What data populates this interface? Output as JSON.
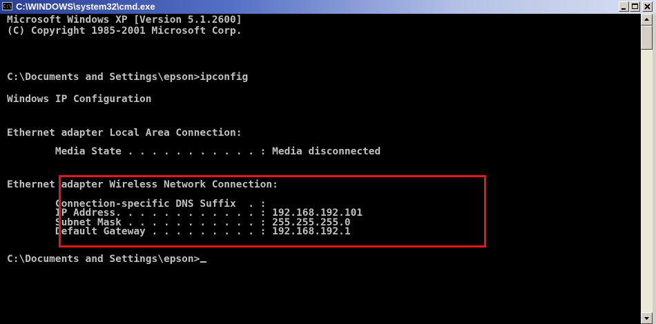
{
  "window": {
    "title": "C:\\WINDOWS\\system32\\cmd.exe",
    "icon": "cmd-icon",
    "icon_text": "C:\\",
    "controls": [
      "minimize",
      "maximize",
      "close"
    ]
  },
  "console": {
    "lines": [
      "Microsoft Windows XP [Version 5.1.2600]",
      "(C) Copyright 1985-2001 Microsoft Corp.",
      "",
      "C:\\Documents and Settings\\epson>ipconfig",
      "",
      "Windows IP Configuration",
      "",
      "",
      "Ethernet adapter Local Area Connection:",
      "",
      "        Media State . . . . . . . . . . . : Media disconnected",
      "",
      "Ethernet adapter Wireless Network Connection:",
      "",
      "        Connection-specific DNS Suffix  . :",
      "        IP Address. . . . . . . . . . . . : 192.168.192.101",
      "        Subnet Mask . . . . . . . . . . . : 255.255.255.0",
      "        Default Gateway . . . . . . . . . : 192.168.192.1",
      "",
      "C:\\Documents and Settings\\epson>"
    ],
    "highlight_color": "#e8151b"
  }
}
